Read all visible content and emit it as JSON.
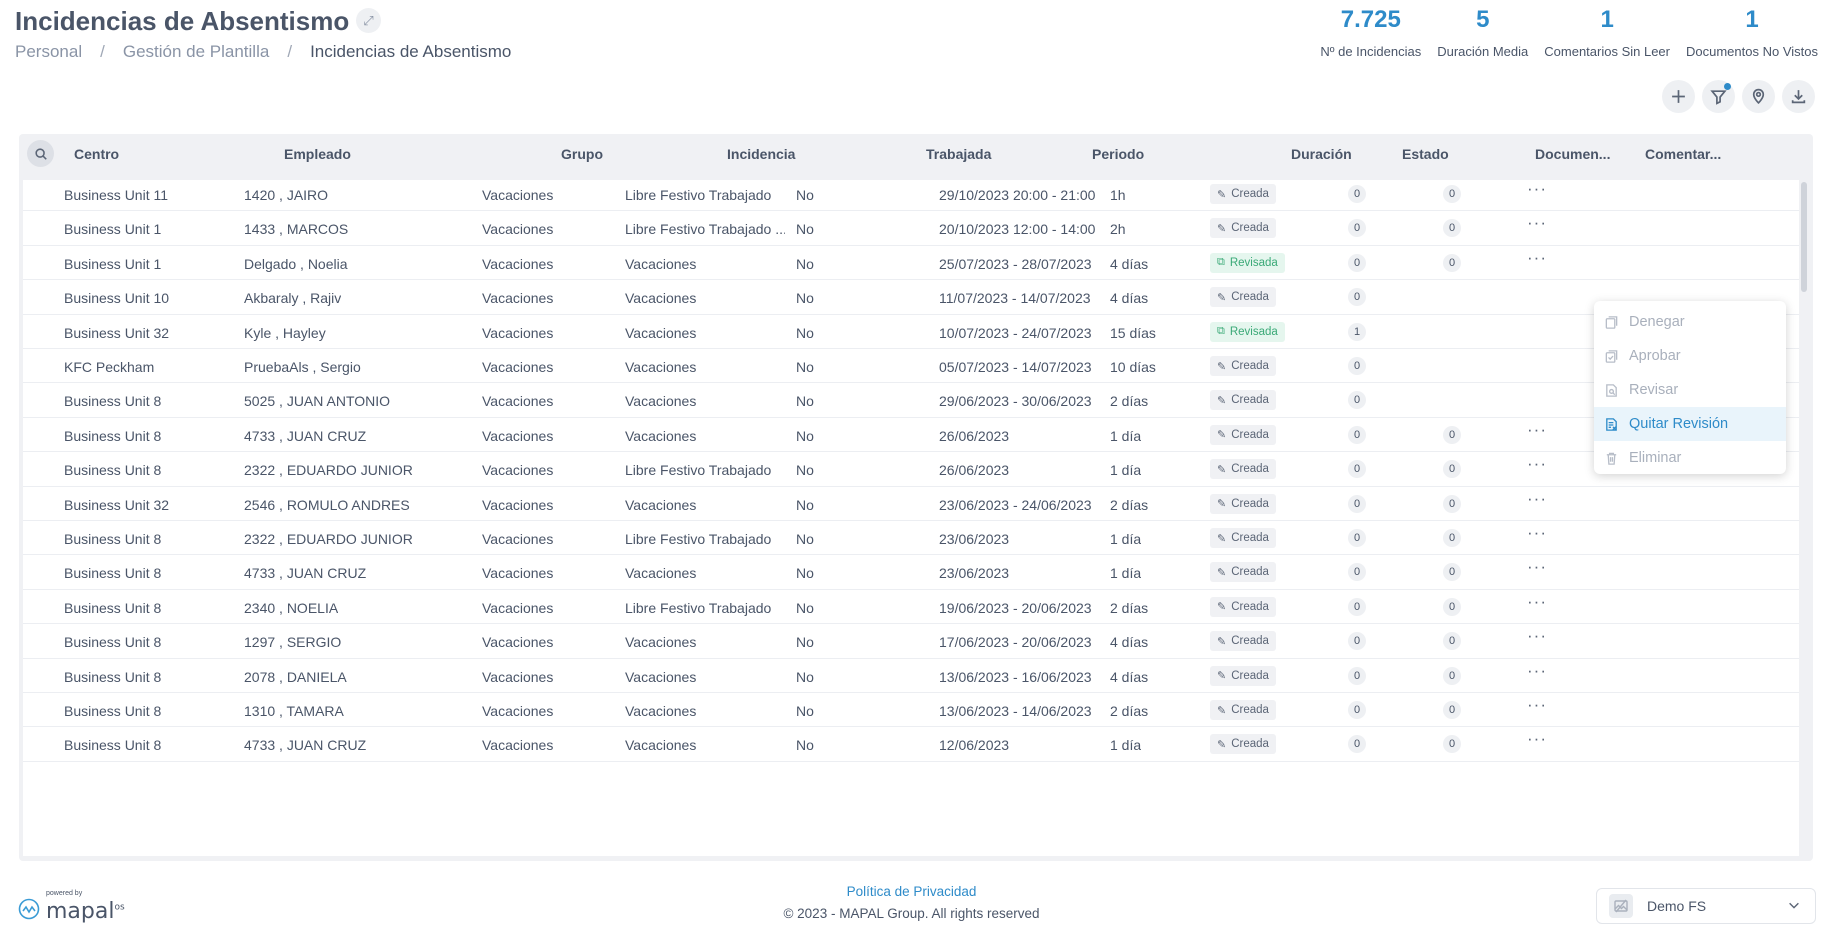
{
  "header": {
    "title": "Incidencias de Absentismo",
    "breadcrumb": [
      "Personal",
      "Gestión de Plantilla",
      "Incidencias de Absentismo"
    ],
    "separator": "/"
  },
  "kpis": [
    {
      "value": "7.725",
      "label": "Nº de Incidencias"
    },
    {
      "value": "5",
      "label": "Duración Media"
    },
    {
      "value": "1",
      "label": "Comentarios Sin Leer"
    },
    {
      "value": "1",
      "label": "Documentos No Vistos"
    }
  ],
  "toolbar": {
    "add": "plus-icon",
    "filter": "filter-icon",
    "location": "location-icon",
    "download": "download-icon"
  },
  "table": {
    "columns": [
      "Centro",
      "Empleado",
      "Grupo",
      "Incidencia",
      "Trabajada",
      "Periodo",
      "Duración",
      "Estado",
      "Documen...",
      "Comentar..."
    ],
    "rows": [
      [
        "Business Unit 11",
        "1420 , JAIRO",
        "Vacaciones",
        "Libre Festivo Trabajado",
        "No",
        "29/10/2023 20:00 - 21:00",
        "1h",
        "Creada",
        "0",
        "0"
      ],
      [
        "Business Unit 1",
        "1433 , MARCOS",
        "Vacaciones",
        "Libre Festivo Trabajado ...",
        "No",
        "20/10/2023 12:00 - 14:00",
        "2h",
        "Creada",
        "0",
        "0"
      ],
      [
        "Business Unit 1",
        "Delgado , Noelia",
        "Vacaciones",
        "Vacaciones",
        "No",
        "25/07/2023 - 28/07/2023",
        "4 días",
        "Revisada",
        "0",
        "0"
      ],
      [
        "Business Unit 10",
        "Akbaraly , Rajiv",
        "Vacaciones",
        "Vacaciones",
        "No",
        "11/07/2023 - 14/07/2023",
        "4 días",
        "Creada",
        "0",
        ""
      ],
      [
        "Business Unit 32",
        "Kyle , Hayley",
        "Vacaciones",
        "Vacaciones",
        "No",
        "10/07/2023 - 24/07/2023",
        "15 días",
        "Revisada",
        "1",
        ""
      ],
      [
        "KFC Peckham",
        "PruebaAls , Sergio",
        "Vacaciones",
        "Vacaciones",
        "No",
        "05/07/2023 - 14/07/2023",
        "10 días",
        "Creada",
        "0",
        ""
      ],
      [
        "Business Unit 8",
        "5025 , JUAN ANTONIO",
        "Vacaciones",
        "Vacaciones",
        "No",
        "29/06/2023 - 30/06/2023",
        "2 días",
        "Creada",
        "0",
        ""
      ],
      [
        "Business Unit 8",
        "4733 , JUAN CRUZ",
        "Vacaciones",
        "Vacaciones",
        "No",
        "26/06/2023",
        "1 día",
        "Creada",
        "0",
        "0"
      ],
      [
        "Business Unit 8",
        "2322 , EDUARDO JUNIOR",
        "Vacaciones",
        "Libre Festivo Trabajado",
        "No",
        "26/06/2023",
        "1 día",
        "Creada",
        "0",
        "0"
      ],
      [
        "Business Unit 32",
        "2546 , ROMULO ANDRES",
        "Vacaciones",
        "Vacaciones",
        "No",
        "23/06/2023 - 24/06/2023",
        "2 días",
        "Creada",
        "0",
        "0"
      ],
      [
        "Business Unit 8",
        "2322 , EDUARDO JUNIOR",
        "Vacaciones",
        "Libre Festivo Trabajado",
        "No",
        "23/06/2023",
        "1 día",
        "Creada",
        "0",
        "0"
      ],
      [
        "Business Unit 8",
        "4733 , JUAN CRUZ",
        "Vacaciones",
        "Vacaciones",
        "No",
        "23/06/2023",
        "1 día",
        "Creada",
        "0",
        "0"
      ],
      [
        "Business Unit 8",
        "2340 , NOELIA",
        "Vacaciones",
        "Libre Festivo Trabajado",
        "No",
        "19/06/2023 - 20/06/2023",
        "2 días",
        "Creada",
        "0",
        "0"
      ],
      [
        "Business Unit 8",
        "1297 , SERGIO",
        "Vacaciones",
        "Vacaciones",
        "No",
        "17/06/2023 - 20/06/2023",
        "4 días",
        "Creada",
        "0",
        "0"
      ],
      [
        "Business Unit 8",
        "2078 , DANIELA",
        "Vacaciones",
        "Vacaciones",
        "No",
        "13/06/2023 - 16/06/2023",
        "4 días",
        "Creada",
        "0",
        "0"
      ],
      [
        "Business Unit 8",
        "1310 , TAMARA",
        "Vacaciones",
        "Vacaciones",
        "No",
        "13/06/2023 - 14/06/2023",
        "2 días",
        "Creada",
        "0",
        "0"
      ],
      [
        "Business Unit 8",
        "4733 , JUAN CRUZ",
        "Vacaciones",
        "Vacaciones",
        "No",
        "12/06/2023",
        "1 día",
        "Creada",
        "0",
        "0"
      ]
    ]
  },
  "context_menu": {
    "items": [
      {
        "label": "Denegar",
        "icon": "deny-icon",
        "enabled": false
      },
      {
        "label": "Aprobar",
        "icon": "approve-icon",
        "enabled": false
      },
      {
        "label": "Revisar",
        "icon": "review-icon",
        "enabled": false
      },
      {
        "label": "Quitar Revisión",
        "icon": "remove-review-icon",
        "enabled": true
      },
      {
        "label": "Eliminar",
        "icon": "trash-icon",
        "enabled": false
      }
    ]
  },
  "footer": {
    "powered_by": "powered by",
    "brand": "mapal",
    "brand_suffix": "os",
    "privacy_link": "Política de Privacidad",
    "copyright": "© 2023 - MAPAL Group. All rights reserved",
    "company": "Demo FS"
  },
  "colors": {
    "accent": "#2e8bc9",
    "reviewed": "#3aa977",
    "text": "#4a5568"
  }
}
